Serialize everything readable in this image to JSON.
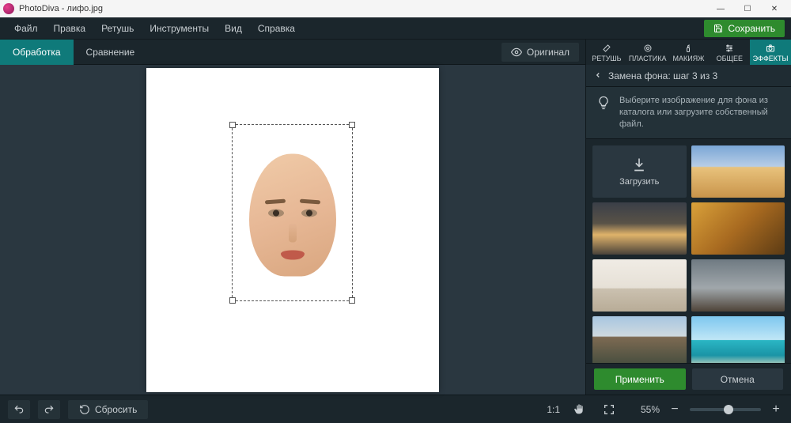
{
  "app": {
    "title": "PhotoDiva - лифо.jpg"
  },
  "menu": {
    "file": "Файл",
    "edit": "Правка",
    "retouch": "Ретушь",
    "tools": "Инструменты",
    "view": "Вид",
    "help": "Справка",
    "save": "Сохранить"
  },
  "tabs": {
    "processing": "Обработка",
    "compare": "Сравнение",
    "original": "Оригинал"
  },
  "right_tabs": {
    "retouch": "РЕТУШЬ",
    "plastic": "ПЛАСТИКА",
    "makeup": "МАКИЯЖ",
    "general": "ОБЩЕЕ",
    "effects": "ЭФФЕКТЫ"
  },
  "panel": {
    "heading": "Замена фона: шаг 3 из 3",
    "hint": "Выберите изображение для фона из каталога или загрузите собственный файл.",
    "upload": "Загрузить",
    "apply": "Применить",
    "cancel": "Отмена"
  },
  "bottom": {
    "reset": "Сбросить",
    "ratio": "1:1",
    "zoom": "55%"
  },
  "bg_thumbs": [
    {
      "name": "desert",
      "css": "linear-gradient(180deg,#7aa6d6 0%,#b7cde6 40%,#e8c27c 42%,#c9944a 100%)"
    },
    {
      "name": "sunset-city",
      "css": "linear-gradient(180deg,#3a3f48 0%,#595247 40%,#e0b36a 62%,#49423a 100%)"
    },
    {
      "name": "autumn-park",
      "css": "linear-gradient(135deg,#d9a13a 0%,#a86a20 50%,#5c3b14 100%)"
    },
    {
      "name": "living-room",
      "css": "linear-gradient(180deg,#f0ece5 0%,#e6e0d6 55%,#cbc1b0 56%,#b8ac97 100%)"
    },
    {
      "name": "nyc-street",
      "css": "linear-gradient(180deg,#6f7a82 0%,#a0a7ab 55%,#4e4338 100%)"
    },
    {
      "name": "canal-houses",
      "css": "linear-gradient(180deg,#a7c6e0 0%,#cfd9df 38%,#7d6a52 40%,#3f4a3c 100%)"
    },
    {
      "name": "tropical-beach",
      "css": "linear-gradient(180deg,#7ec7ef 0%,#bfe6f6 45%,#2bb6c4 46%,#1a94a6 75%,#efe4c6 100%)"
    },
    {
      "name": "tulip-field",
      "css": "linear-gradient(180deg,#b8cfa4 0%,#9abf86 35%,#d85a7a 55%,#c13a5e 100%)"
    },
    {
      "name": "paper-texture",
      "css": "linear-gradient(135deg,#f2efe8 0%,#e3ded2 50%,#eee9dd 100%)"
    }
  ]
}
